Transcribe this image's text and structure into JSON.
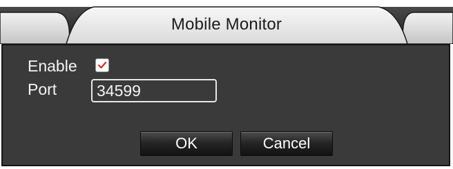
{
  "dialog": {
    "title": "Mobile Monitor"
  },
  "form": {
    "enable_label": "Enable",
    "enable_checked": true,
    "port_label": "Port",
    "port_value": "34599"
  },
  "buttons": {
    "ok_label": "OK",
    "cancel_label": "Cancel"
  },
  "colors": {
    "panel_bg": "#3a3a3a",
    "title_tab": "#e6e6e6",
    "titlebar_dark": "#2e2e2e",
    "checkmark": "#d42a1e"
  },
  "icons": {
    "checkbox_mark": "checkmark-icon"
  }
}
